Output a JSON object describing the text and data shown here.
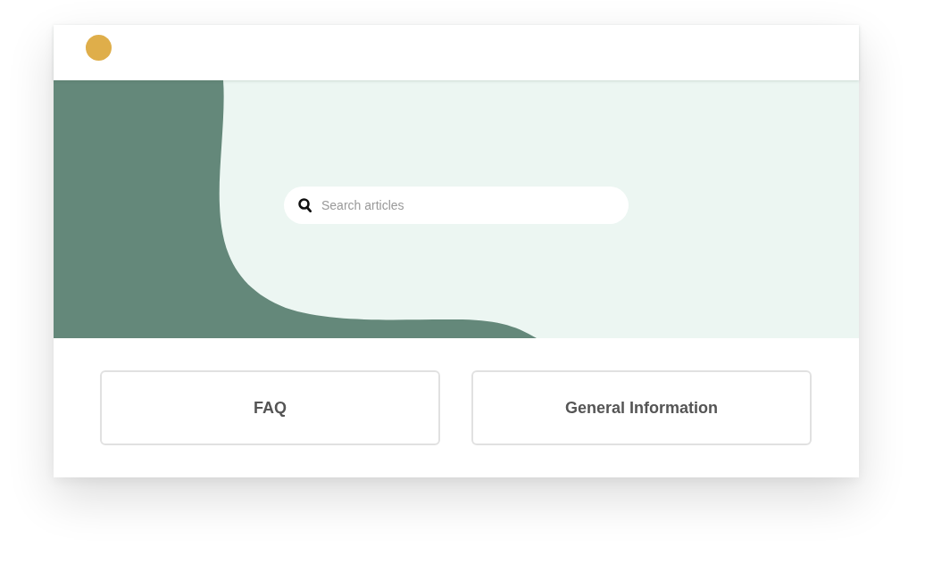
{
  "search": {
    "placeholder": "Search articles"
  },
  "categories": [
    {
      "label": "FAQ"
    },
    {
      "label": "General Information"
    }
  ]
}
